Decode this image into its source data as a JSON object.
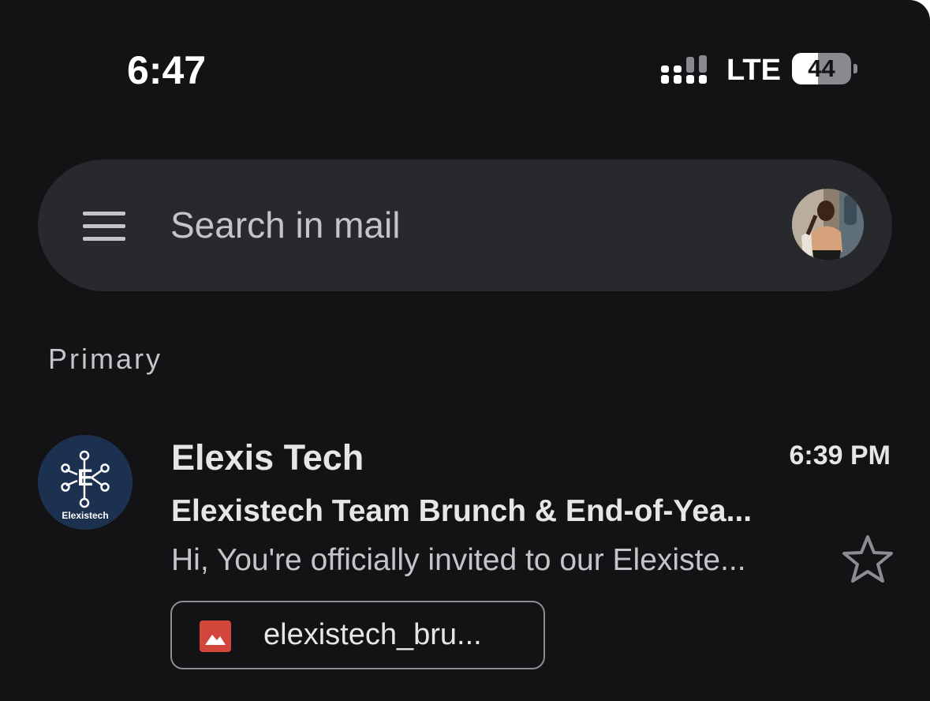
{
  "status_bar": {
    "time": "6:47",
    "carrier": "LTE",
    "battery_level": "44",
    "battery_fraction": 0.44,
    "signal_bars_active": 2,
    "signal_bars_total": 4
  },
  "search": {
    "placeholder": "Search in mail",
    "menu_icon": "hamburger-menu-icon",
    "avatar": "user-avatar-photo"
  },
  "section": {
    "label": "Primary"
  },
  "emails": [
    {
      "sender": "Elexis Tech",
      "sender_logo_text": "Elexistech",
      "time": "6:39 PM",
      "subject": "Elexistech Team Brunch & End-of-Yea...",
      "snippet": "Hi, You're officially invited to our Elexiste...",
      "starred": false,
      "attachment": {
        "name": "elexistech_bru...",
        "icon": "image-file-icon"
      }
    }
  ],
  "colors": {
    "background": "#131316",
    "searchbar": "#28292c",
    "sender_logo_bg": "#1c3150",
    "image_icon": "#d3463c",
    "text_primary": "#e6e6e8",
    "text_secondary": "#c4c5c9"
  }
}
